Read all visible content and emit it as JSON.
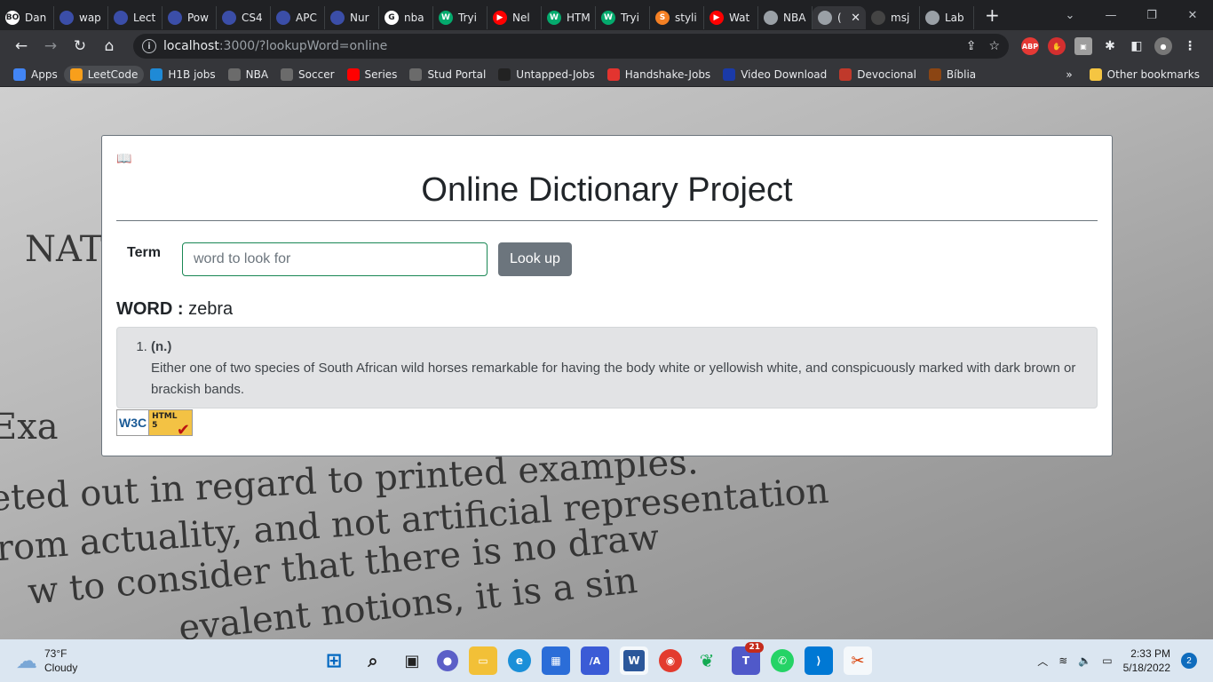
{
  "browser": {
    "tabs": [
      {
        "label": "Dan",
        "fav_color": "#ffffff",
        "fav_text": "BO"
      },
      {
        "label": "wap",
        "fav_color": "#3b4ea8",
        "fav_text": ""
      },
      {
        "label": "Lect",
        "fav_color": "#3b4ea8",
        "fav_text": ""
      },
      {
        "label": "Pow",
        "fav_color": "#3b4ea8",
        "fav_text": ""
      },
      {
        "label": "CS4",
        "fav_color": "#3b4ea8",
        "fav_text": ""
      },
      {
        "label": "APC",
        "fav_color": "#3b4ea8",
        "fav_text": ""
      },
      {
        "label": "Nur",
        "fav_color": "#3b4ea8",
        "fav_text": ""
      },
      {
        "label": "nba",
        "fav_color": "#ffffff",
        "fav_text": "G"
      },
      {
        "label": "Tryi",
        "fav_color": "#04aa6d",
        "fav_text": "W"
      },
      {
        "label": "Nel",
        "fav_color": "#ff0000",
        "fav_text": "▶"
      },
      {
        "label": "HTM",
        "fav_color": "#04aa6d",
        "fav_text": "W"
      },
      {
        "label": "Tryi",
        "fav_color": "#04aa6d",
        "fav_text": "W"
      },
      {
        "label": "styli",
        "fav_color": "#f48024",
        "fav_text": "S"
      },
      {
        "label": "Wat",
        "fav_color": "#ff0000",
        "fav_text": "▶"
      },
      {
        "label": "NBA",
        "fav_color": "#9aa0a6",
        "fav_text": ""
      },
      {
        "label": "(",
        "fav_color": "#9aa0a6",
        "fav_text": "",
        "active": true
      },
      {
        "label": "msj",
        "fav_color": "#444444",
        "fav_text": ""
      },
      {
        "label": "Lab",
        "fav_color": "#9aa0a6",
        "fav_text": ""
      }
    ],
    "new_tab": "+",
    "url_host": "localhost",
    "url_path": ":3000/?lookupWord=online",
    "bookmarks": [
      {
        "label": "Apps",
        "color": "#4285f4"
      },
      {
        "label": "LeetCode",
        "color": "#f89f1b"
      },
      {
        "label": "H1B jobs",
        "color": "#1f8ad6"
      },
      {
        "label": "NBA",
        "color": "#6b6b6b"
      },
      {
        "label": "Soccer",
        "color": "#6b6b6b"
      },
      {
        "label": "Series",
        "color": "#ff0000"
      },
      {
        "label": "Stud Portal",
        "color": "#6b6b6b"
      },
      {
        "label": "Untapped-Jobs",
        "color": "#222222"
      },
      {
        "label": "Handshake-Jobs",
        "color": "#e3342f"
      },
      {
        "label": "Video Download",
        "color": "#1a3aa8"
      },
      {
        "label": "Devocional",
        "color": "#c0392b"
      },
      {
        "label": "Bíblia",
        "color": "#8b4513"
      }
    ],
    "bookmarks_more": "»",
    "other_bookmarks": "Other bookmarks"
  },
  "page": {
    "title": "Online Dictionary Project",
    "term_label": "Term",
    "input_placeholder": "word to look for",
    "button_label": "Look up",
    "word_prefix": "WORD : ",
    "word": "zebra",
    "definitions": [
      {
        "pos": "(n.)",
        "text": "Either one of two species of South African wild horses remarkable for having the body white or yellowish white, and conspicuously marked with dark brown or brackish bands."
      }
    ],
    "badge_w3c": "W3C",
    "badge_html": "HTML",
    "badge_version": "5"
  },
  "taskbar": {
    "temperature": "73°F",
    "condition": "Cloudy",
    "time": "2:33 PM",
    "date": "5/18/2022",
    "teams_badge": "21",
    "notifications": "2"
  }
}
